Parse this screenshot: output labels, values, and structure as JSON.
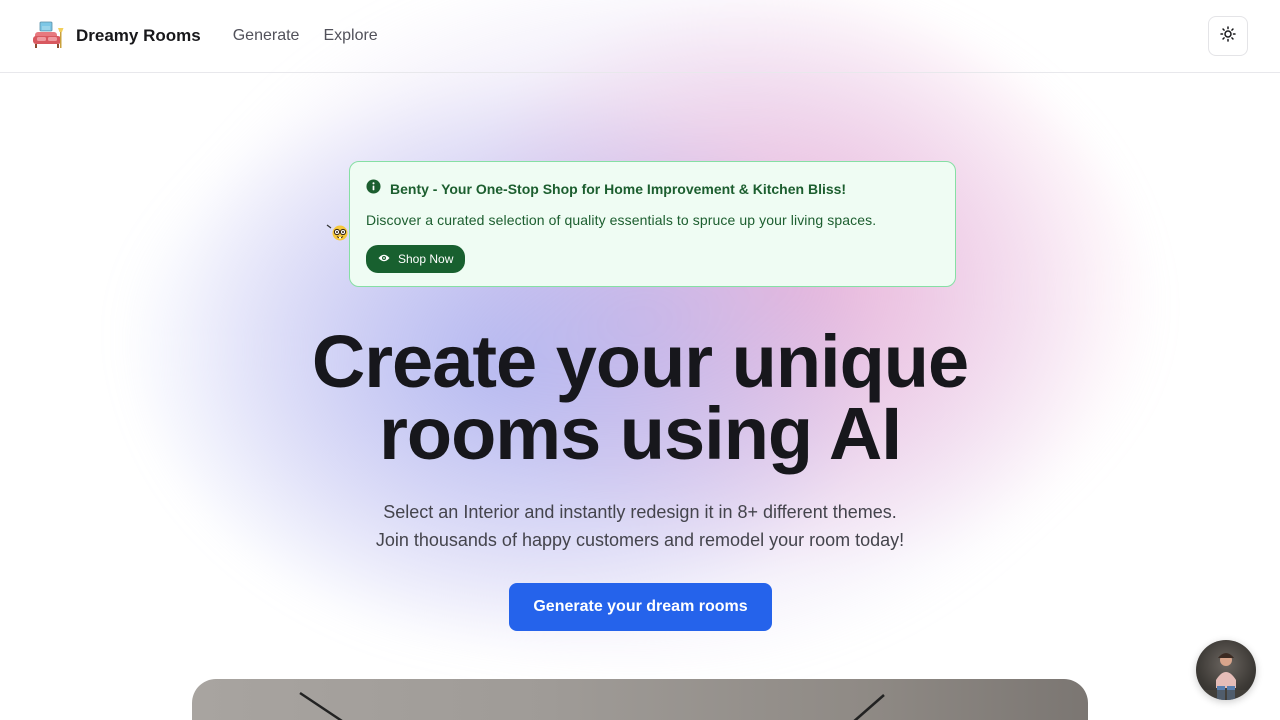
{
  "app": {
    "name": "Dreamy Rooms",
    "logo_icon": "couch-icon"
  },
  "nav": {
    "items": [
      {
        "label": "Generate"
      },
      {
        "label": "Explore"
      }
    ]
  },
  "theme_toggle": {
    "icon": "sun-icon"
  },
  "banner": {
    "icon": "info-circle-icon",
    "title": "Benty - Your One-Stop Shop for Home Improvement & Kitchen Bliss!",
    "description": "Discover a curated selection of quality essentials to spruce up your living spaces.",
    "button_label": "Shop Now",
    "button_icon": "eye-icon",
    "side_icon": "nerd-face-icon"
  },
  "hero": {
    "title_line1": "Create your unique",
    "title_line2": "rooms using AI",
    "subtitle_line1": "Select an Interior and instantly redesign it in 8+ different themes.",
    "subtitle_line2": "Join thousands of happy customers and remodel your room today!"
  },
  "cta": {
    "label": "Generate your dream rooms"
  },
  "colors": {
    "accent": "#2563eb",
    "banner_bg": "#effcf3",
    "banner_text": "#1c5e2f",
    "shop_button": "#18602f"
  }
}
